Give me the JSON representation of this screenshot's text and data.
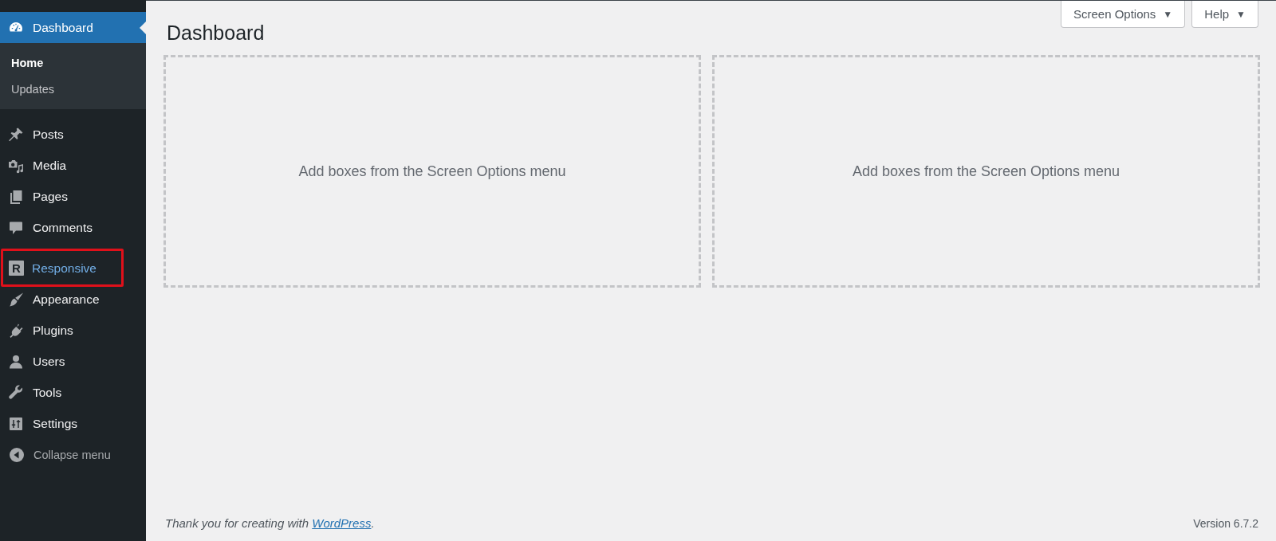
{
  "sidebar": {
    "sections": [
      {
        "items": [
          {
            "label": "Dashboard",
            "selected": true,
            "highlighted": false,
            "children": [
              {
                "label": "Home",
                "selected": true
              },
              {
                "label": "Updates",
                "selected": false
              }
            ]
          }
        ]
      },
      {
        "items": [
          {
            "label": "Posts",
            "selected": false,
            "highlighted": false
          },
          {
            "label": "Media",
            "selected": false,
            "highlighted": false
          },
          {
            "label": "Pages",
            "selected": false,
            "highlighted": false
          },
          {
            "label": "Comments",
            "selected": false,
            "highlighted": false
          }
        ]
      },
      {
        "items": [
          {
            "label": "Responsive",
            "icon_letter": "R",
            "selected": false,
            "highlighted": true
          },
          {
            "label": "Appearance",
            "selected": false,
            "highlighted": false
          },
          {
            "label": "Plugins",
            "selected": false,
            "highlighted": false
          },
          {
            "label": "Users",
            "selected": false,
            "highlighted": false
          },
          {
            "label": "Tools",
            "selected": false,
            "highlighted": false
          },
          {
            "label": "Settings",
            "selected": false,
            "highlighted": false
          }
        ]
      }
    ],
    "collapse": {
      "label": "Collapse menu"
    }
  },
  "header": {
    "title": "Dashboard",
    "buttons": [
      {
        "label": "Screen Options",
        "caret": "▼"
      },
      {
        "label": "Help",
        "caret": "▼"
      }
    ]
  },
  "boxes": [
    {
      "message": "Add boxes from the Screen Options menu"
    },
    {
      "message": "Add boxes from the Screen Options menu"
    }
  ],
  "footer": {
    "credit": {
      "before": "Thank you for creating with",
      "link": "WordPress",
      "after": "."
    },
    "version": "Version 6.7.2"
  }
}
